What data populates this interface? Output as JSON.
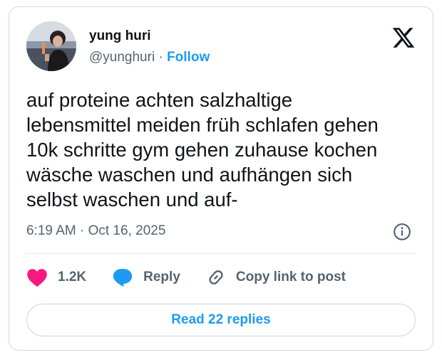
{
  "author": {
    "name": "yung huri",
    "handle": "@yunghuri",
    "separator": "·",
    "follow_label": "Follow"
  },
  "tweet": {
    "text": "auf proteine achten salzhaltige\nlebensmittel meiden früh schlafen gehen\n10k schritte gym gehen zuhause kochen\nwäsche waschen und aufhängen sich\nselbst waschen und auf-",
    "timestamp": "6:19 AM · Oct 16, 2025"
  },
  "actions": {
    "like_count": "1.2K",
    "reply_label": "Reply",
    "copy_label": "Copy link to post"
  },
  "footer": {
    "read_replies_label": "Read 22 replies"
  },
  "colors": {
    "like": "#f91880",
    "reply": "#1d9bf0",
    "accent": "#1d9bf0",
    "secondary_text": "#536471"
  },
  "icons": {
    "logo": "x-logo-icon",
    "info": "info-icon",
    "like": "heart-icon",
    "reply": "speech-bubble-icon",
    "copy": "link-icon"
  }
}
